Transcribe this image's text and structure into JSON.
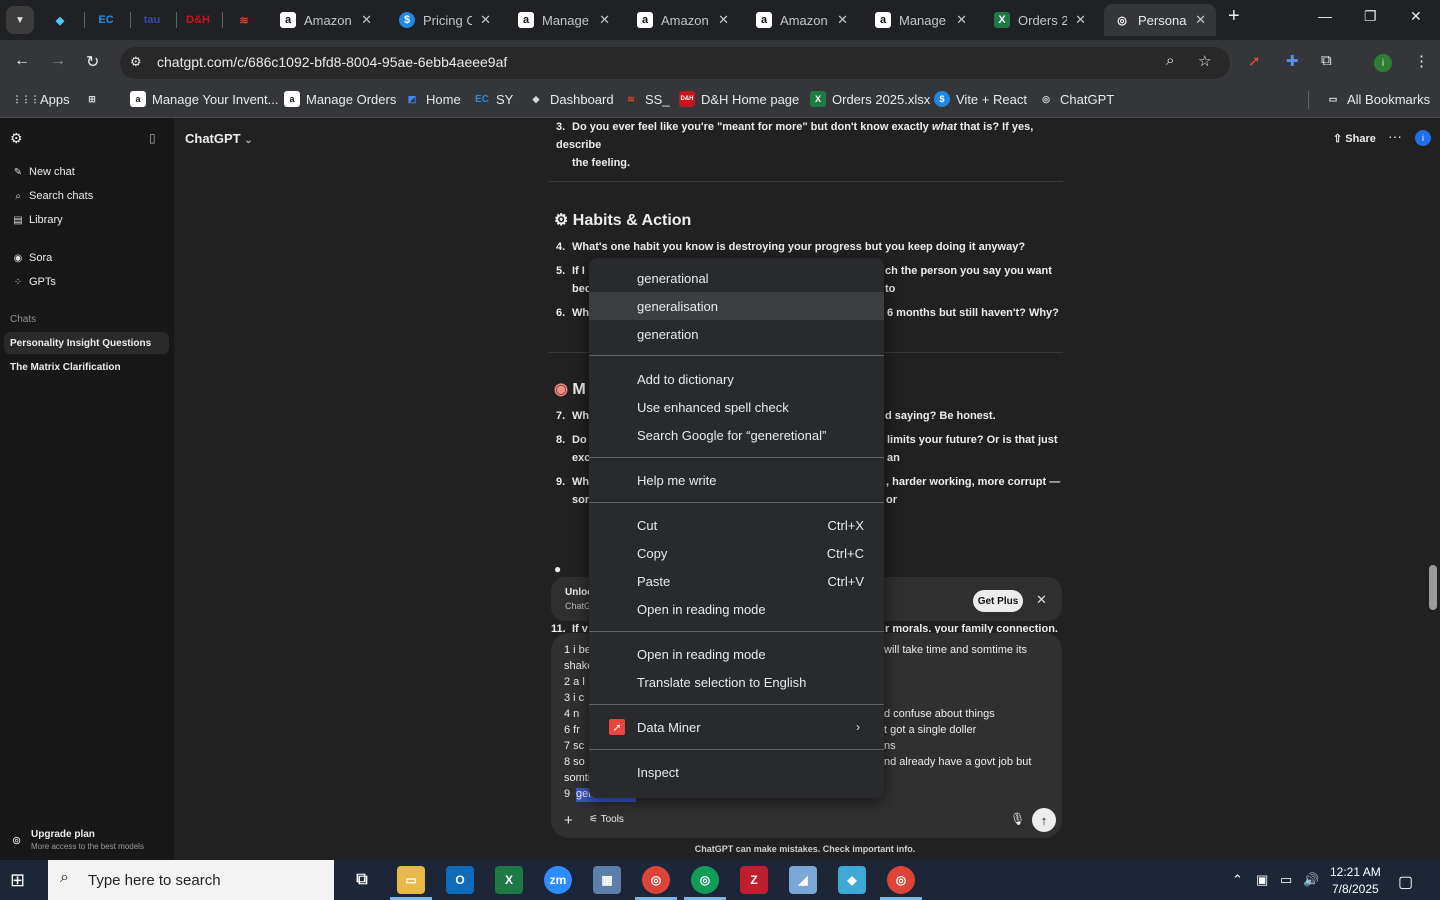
{
  "browser": {
    "pinned_tabs": [
      {
        "name": "pinned-tab-1",
        "glyph": "◆",
        "color": "#4fc3f7"
      },
      {
        "name": "pinned-tab-ec",
        "glyph": "EC",
        "color": "#2b8ad8"
      },
      {
        "name": "pinned-tab-tau",
        "glyph": "tau",
        "color": "#3b4aa8"
      },
      {
        "name": "pinned-tab-dh",
        "glyph": "D&H",
        "color": "#c4161c"
      },
      {
        "name": "pinned-tab-ss",
        "glyph": "≋",
        "color": "#c24a2a"
      }
    ],
    "tabs": [
      {
        "title": "Amazon",
        "fav": "a"
      },
      {
        "title": "Pricing C",
        "fav": "$"
      },
      {
        "title": "Manage",
        "fav": "a"
      },
      {
        "title": "Amazon",
        "fav": "a"
      },
      {
        "title": "Amazon",
        "fav": "a"
      },
      {
        "title": "Manage",
        "fav": "a"
      },
      {
        "title": "Orders 2",
        "fav": "X"
      },
      {
        "title": "Personal",
        "fav": "◎"
      }
    ],
    "url": "chatgpt.com/c/686c1092-bfd8-8004-95ae-6ebb4aeee9af",
    "bookmarks": [
      {
        "label": "Apps",
        "fav": "⋮⋮⋮"
      },
      {
        "label": "",
        "fav": "⊞"
      },
      {
        "label": "Manage Your Invent...",
        "fav": "a"
      },
      {
        "label": "Manage Orders",
        "fav": "a"
      },
      {
        "label": "Home",
        "fav": "◩"
      },
      {
        "label": "SY",
        "fav": "EC"
      },
      {
        "label": "Dashboard",
        "fav": "◆"
      },
      {
        "label": "SS_",
        "fav": "≋"
      },
      {
        "label": "D&H Home page",
        "fav": "D&H"
      },
      {
        "label": "Orders 2025.xlsx",
        "fav": "X"
      },
      {
        "label": "Vite + React",
        "fav": "$"
      },
      {
        "label": "ChatGPT",
        "fav": "◎"
      }
    ],
    "all_bookmarks": "All Bookmarks"
  },
  "sidebar": {
    "items": [
      {
        "icon": "✎",
        "label": "New chat"
      },
      {
        "icon": "⌕",
        "label": "Search chats"
      },
      {
        "icon": "▤",
        "label": "Library"
      },
      {
        "icon": "◉",
        "label": "Sora"
      },
      {
        "icon": "⁘",
        "label": "GPTs"
      }
    ],
    "chats_heading": "Chats",
    "chats": [
      "Personality Insight Questions",
      "The Matrix Clarification"
    ],
    "upgrade_title": "Upgrade plan",
    "upgrade_sub": "More access to the best models"
  },
  "header": {
    "model": "ChatGPT",
    "share": "Share"
  },
  "content": {
    "q3_num": "3.",
    "q3_l1a": "Do you ever feel like you're \"meant for more\" but don't know exactly ",
    "q3_em": "what",
    "q3_l1b": " that is? If yes, describe",
    "q3_l2": "the feeling.",
    "section_habits": "Habits & Action",
    "q4_num": "4.",
    "q4": "What's one habit you know is destroying your progress but you keep doing it anyway?",
    "q5_num": "5.",
    "q5_a": "If I",
    "q5_b": "ch the person you say you want to",
    "q5_c": "bec",
    "q6_num": "6.",
    "q6_a": "Wh",
    "q6_b": "6 months but still haven't? Why?",
    "section_m": "M",
    "q7_num": "7.",
    "q7_a": "Wh",
    "q7_b": "d saying? Be honest.",
    "q8_num": "8.",
    "q8_a": "Do",
    "q8_b": "limits your future? Or is that just an",
    "q8_c": "exc",
    "q9_num": "9.",
    "q9_a": "Wh",
    "q9_b": ", harder working, more corrupt — or",
    "q9_c": "son",
    "q11_num": "11.",
    "q11_a": "If v",
    "q11_b": "r morals. your family connection."
  },
  "banner": {
    "line1": "Unloc",
    "line2": "ChatG",
    "get_plus": "Get Plus"
  },
  "composer": {
    "l1a": "1 i be",
    "l1b": "will take time and somtime its",
    "l2": "shake",
    "l3": "2  a l",
    "l4": "3   i c",
    "l5a": "4   n",
    "l5b": "d confuse about things",
    "l6a": "6   fr",
    "l6b": "t got a single doller",
    "l7a": "7   sc",
    "l7b": "ns",
    "l8a": "8   so",
    "l8b": "nd already have a govt job  but",
    "l9": "somti",
    "l10a": "9  ",
    "l10b": "gen",
    "tools": "Tools"
  },
  "disclaimer": "ChatGPT can make mistakes. Check important info.",
  "context_menu": {
    "suggestions": [
      "generational",
      "generalisation",
      "generation"
    ],
    "add_dict": "Add to dictionary",
    "enhanced": "Use enhanced spell check",
    "search_google": "Search Google for “generetional”",
    "help_write": "Help me write",
    "cut": "Cut",
    "cut_sc": "Ctrl+X",
    "copy": "Copy",
    "copy_sc": "Ctrl+C",
    "paste": "Paste",
    "paste_sc": "Ctrl+V",
    "reading1": "Open in reading mode",
    "reading2": "Open in reading mode",
    "translate": "Translate selection to English",
    "data_miner": "Data Miner",
    "inspect": "Inspect"
  },
  "taskbar": {
    "search_placeholder": "Type here to search",
    "time": "12:21 AM",
    "date": "7/8/2025"
  }
}
